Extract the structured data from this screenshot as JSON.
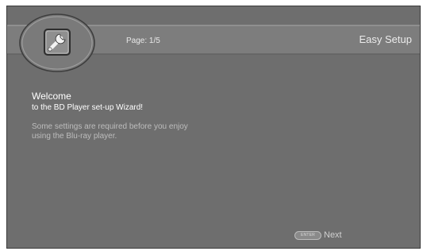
{
  "header": {
    "page_indicator": "Page: 1/5",
    "title": "Easy Setup",
    "logo_icon": "wrench-icon"
  },
  "content": {
    "heading": "Welcome",
    "subheading": "to the BD Player set-up Wizard!",
    "body_line_1": "Some settings are required before you enjoy",
    "body_line_2": "using the Blu-ray player."
  },
  "footer": {
    "enter_badge": "ENTER",
    "next_label": "Next"
  },
  "colors": {
    "background": "#6e6e6e",
    "header_band": "#7d7d7d",
    "text_primary": "#ffffff",
    "text_secondary": "#bdbdbd"
  }
}
